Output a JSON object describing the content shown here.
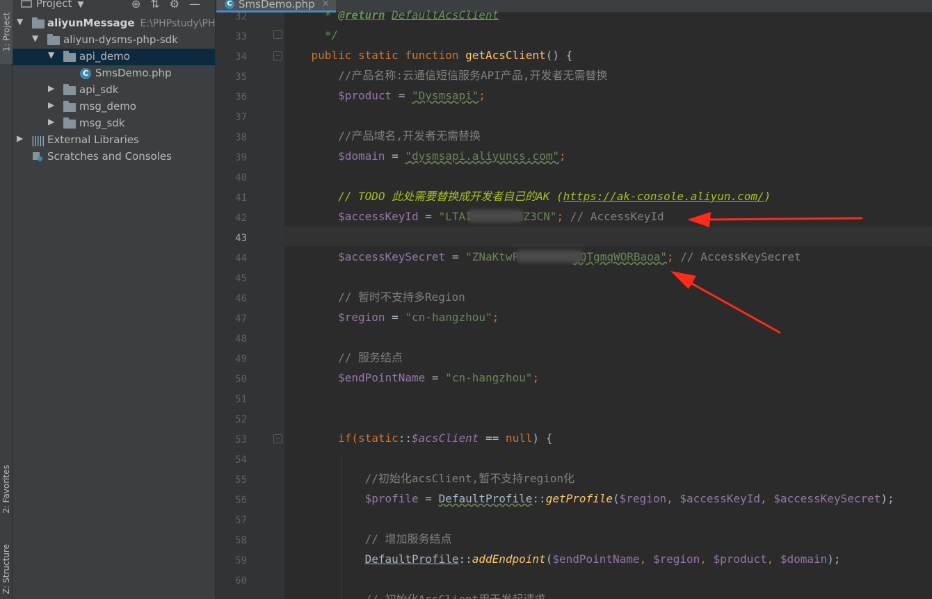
{
  "sidebar_tabs": {
    "project": "1: Project",
    "favorites": "2: Favorites",
    "structure": "Z: Structure"
  },
  "project_panel": {
    "title": "Project",
    "tree": [
      {
        "label": "aliyunMessage",
        "path": "E:\\PHPstudy\\PHP"
      },
      {
        "label": "aliyun-dysms-php-sdk"
      },
      {
        "label": "api_demo"
      },
      {
        "label": "SmsDemo.php"
      },
      {
        "label": "api_sdk"
      },
      {
        "label": "msg_demo"
      },
      {
        "label": "msg_sdk"
      },
      {
        "label": "External Libraries"
      },
      {
        "label": "Scratches and Consoles"
      }
    ]
  },
  "editor": {
    "tab": "SmsDemo.php",
    "tab_close": "×",
    "line_numbers": [
      "32",
      "33",
      "34",
      "35",
      "36",
      "37",
      "38",
      "39",
      "40",
      "41",
      "42",
      "43",
      "44",
      "45",
      "46",
      "47",
      "48",
      "49",
      "50",
      "51",
      "52",
      "53",
      "54",
      "55",
      "56",
      "57",
      "58",
      "59",
      "60"
    ],
    "code": {
      "l32_star": "* ",
      "l32_tag": "@return",
      "l32_type": "DefaultAcsClient",
      "l33": "*/",
      "l34_kw": "public static function ",
      "l34_fn": "getAcsClient",
      "l34_rest": "() {",
      "l35": "//产品名称:云通信短信服务API产品,开发者无需替换",
      "l36_var": "$product",
      "l36_eq": " = ",
      "l36_str": "\"Dysmsapi\"",
      "l36_end": ";",
      "l38": "//产品域名,开发者无需替换",
      "l39_var": "$domain",
      "l39_eq": " = ",
      "l39_str": "\"dysmsapi.aliyuncs.com\"",
      "l39_end": ";",
      "l41_todo": "// TODO 此处需要替换成开发者自己的AK (",
      "l41_link": "https://ak-console.aliyun.com/",
      "l41_close": ")",
      "l42_var": "$accessKeyId",
      "l42_eq": " = ",
      "l42_str1": "\"LTAI",
      "l42_str2": "3Z3CN\"",
      "l42_end": ";",
      "l42_cmt": " // AccessKeyId",
      "l44_var": "$accessKeySecret",
      "l44_eq": " = ",
      "l44_str1": "\"ZNaKtwP",
      "l44_str2": "1QTgmqWORBaoa\"",
      "l44_end": ";",
      "l44_cmt": " // AccessKeySecret",
      "l46": "// 暂时不支持多Region",
      "l47_var": "$region",
      "l47_eq": " = ",
      "l47_str": "\"cn-hangzhou\"",
      "l47_end": ";",
      "l49": "// 服务结点",
      "l50_var": "$endPointName",
      "l50_eq": " = ",
      "l50_str": "\"cn-hangzhou\"",
      "l50_end": ";",
      "l53_if": "if(",
      "l53_static": "static",
      "l53_sep": "::",
      "l53_var": "$acsClient",
      "l53_op": " == ",
      "l53_null": "null",
      "l53_end": ") {",
      "l55": "//初始化acsClient,暂不支持region化",
      "l56_var": "$profile",
      "l56_eq": " = ",
      "l56_cls": "DefaultProfile",
      "l56_sep": "::",
      "l56_fn": "getProfile",
      "l56_open": "(",
      "l56_a1": "$region",
      "l56_c1": ", ",
      "l56_a2": "$accessKeyId",
      "l56_c2": ", ",
      "l56_a3": "$accessKeySecret",
      "l56_end": ");",
      "l58": "// 增加服务结点",
      "l59_cls": "DefaultProfile",
      "l59_sep": "::",
      "l59_fn": "addEndpoint",
      "l59_open": "(",
      "l59_a1": "$endPointName",
      "l59_c1": ", ",
      "l59_a2": "$region",
      "l59_c2": ", ",
      "l59_a3": "$product",
      "l59_c3": ", ",
      "l59_a4": "$domain",
      "l59_end": ");",
      "l61": "// 初始化AcsClient用于发起请求"
    }
  },
  "colors": {
    "annotation_arrow": "#ff2a1a",
    "editor_bg": "#2b2b2b",
    "selection": "#0d293e"
  }
}
